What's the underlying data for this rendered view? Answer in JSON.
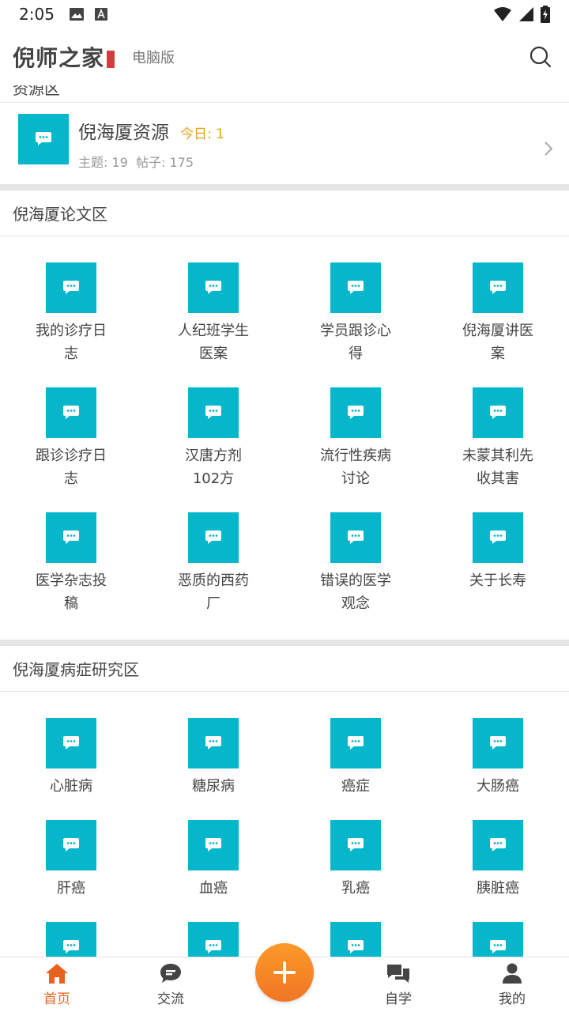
{
  "status_bar": {
    "time": "2:05"
  },
  "header": {
    "logo": "倪师之家",
    "desktop_link": "电脑版"
  },
  "resource_section": {
    "partial_title": "资源区",
    "board": {
      "name": "倪海厦资源",
      "today": "今日: 1",
      "stats": "主题: 19  帖子: 175"
    }
  },
  "thesis_section": {
    "title": "倪海厦论文区",
    "items": [
      {
        "label": "我的诊疗日志"
      },
      {
        "label": "人纪班学生医案"
      },
      {
        "label": "学员跟诊心得"
      },
      {
        "label": "倪海厦讲医案"
      },
      {
        "label": "跟诊诊疗日志"
      },
      {
        "label": "汉唐方剂102方"
      },
      {
        "label": "流行性疾病讨论"
      },
      {
        "label": "未蒙其利先收其害"
      },
      {
        "label": "医学杂志投稿"
      },
      {
        "label": "恶质的西药厂"
      },
      {
        "label": "错误的医学观念"
      },
      {
        "label": "关于长寿"
      }
    ]
  },
  "disease_section": {
    "title": "倪海厦病症研究区",
    "items": [
      {
        "label": "心脏病"
      },
      {
        "label": "糖尿病"
      },
      {
        "label": "癌症"
      },
      {
        "label": "大肠癌"
      },
      {
        "label": "肝癌"
      },
      {
        "label": "血癌"
      },
      {
        "label": "乳癌"
      },
      {
        "label": "胰脏癌"
      },
      {
        "label": ""
      },
      {
        "label": ""
      },
      {
        "label": ""
      },
      {
        "label": ""
      }
    ]
  },
  "bottom_nav": {
    "home": "首页",
    "exchange": "交流",
    "self_study": "自学",
    "mine": "我的"
  },
  "colors": {
    "board_icon": "#06b6cb",
    "accent": "#e8621f",
    "today": "#e8a21b"
  }
}
